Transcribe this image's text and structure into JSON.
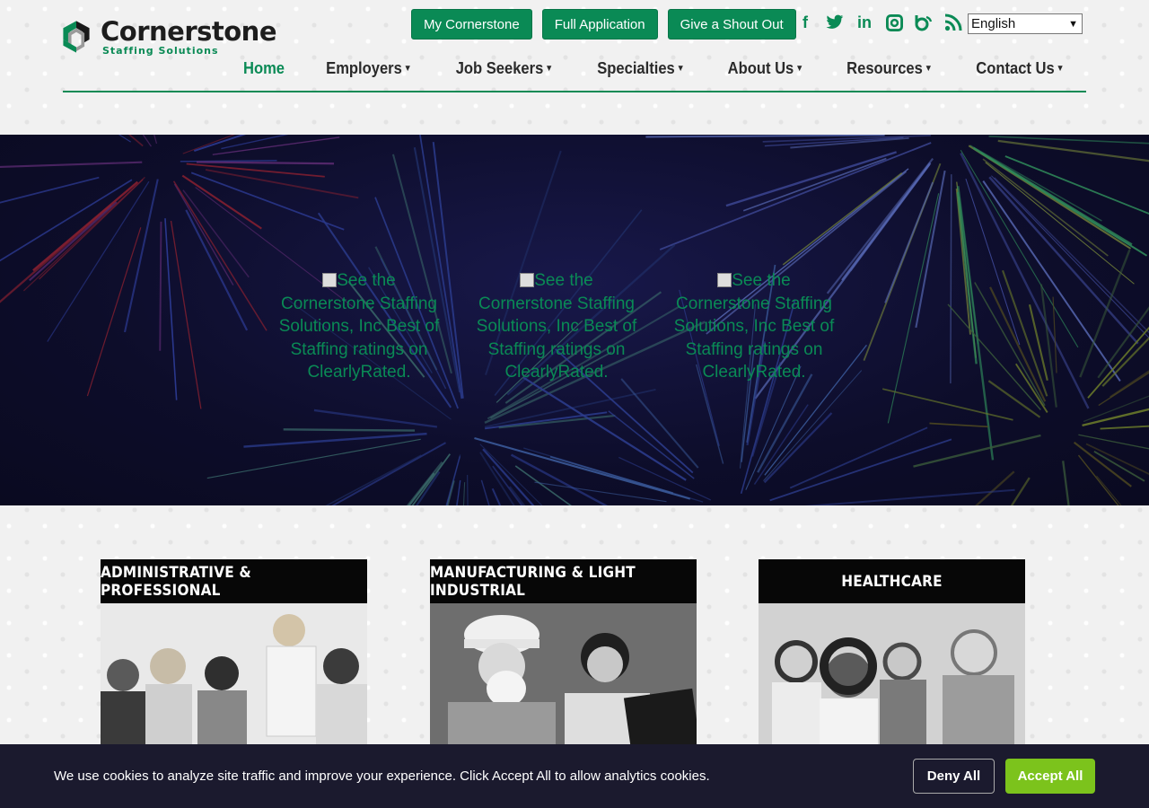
{
  "brand": {
    "name": "Cornerstone",
    "tagline": "Staffing Solutions",
    "accent": "#0a8a55"
  },
  "top_buttons": [
    "My Cornerstone",
    "Full Application",
    "Give a Shout Out"
  ],
  "social_icons": [
    "facebook-icon",
    "twitter-icon",
    "linkedin-icon",
    "instagram-icon",
    "blog-icon",
    "rss-icon"
  ],
  "language": {
    "selected": "English"
  },
  "nav": [
    {
      "label": "Home",
      "active": true,
      "dropdown": false
    },
    {
      "label": "Employers",
      "active": false,
      "dropdown": true
    },
    {
      "label": "Job Seekers",
      "active": false,
      "dropdown": true
    },
    {
      "label": "Specialties",
      "active": false,
      "dropdown": true
    },
    {
      "label": "About Us",
      "active": false,
      "dropdown": true
    },
    {
      "label": "Resources",
      "active": false,
      "dropdown": true
    },
    {
      "label": "Contact Us",
      "active": false,
      "dropdown": true
    }
  ],
  "hero": {
    "badges": [
      "See the Cornerstone Staffing Solutions, Inc Best of Staffing ratings on ClearlyRated.",
      "See the Cornerstone Staffing Solutions, Inc Best of Staffing ratings on ClearlyRated.",
      "See the Cornerstone Staffing Solutions, Inc Best of Staffing ratings on ClearlyRated."
    ]
  },
  "specialties": [
    {
      "title": "ADMINISTRATIVE & PROFESSIONAL"
    },
    {
      "title": "MANUFACTURING & LIGHT INDUSTRIAL"
    },
    {
      "title": "HEALTHCARE"
    }
  ],
  "cookie": {
    "message": "We use cookies to analyze site traffic and improve your experience. Click Accept All to allow analytics cookies.",
    "deny_label": "Deny All",
    "accept_label": "Accept All",
    "accept_color": "#7cc31c"
  }
}
